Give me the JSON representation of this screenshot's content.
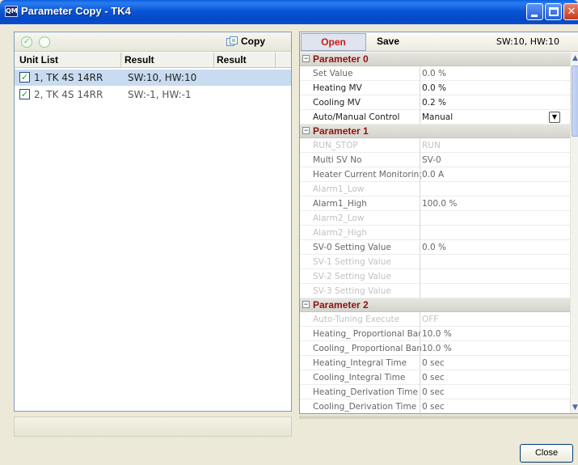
{
  "window": {
    "app_icon": "QM",
    "title": "Parameter Copy - TK4"
  },
  "left_panel": {
    "copy_label": "Copy",
    "headers": [
      "Unit List",
      "Result",
      "Result"
    ],
    "units": [
      {
        "label": "1, TK 4S 14RR",
        "result": "SW:10, HW:10",
        "checked": true,
        "selected": true
      },
      {
        "label": "2, TK 4S 14RR",
        "result": "SW:-1, HW:-1",
        "checked": true,
        "selected": false
      }
    ]
  },
  "right_panel": {
    "open_label": "Open",
    "save_label": "Save",
    "version": "SW:10, HW:10",
    "groups": [
      {
        "name": "Parameter 0",
        "rows": [
          {
            "name": "Set Value",
            "value": "0.0 %",
            "state": "gray"
          },
          {
            "name": "Heating MV",
            "value": "0.0 %",
            "state": "normal"
          },
          {
            "name": "Cooling MV",
            "value": "0.2 %",
            "state": "normal"
          },
          {
            "name": "Auto/Manual Control",
            "value": "Manual",
            "state": "normal",
            "dropdown": true
          }
        ]
      },
      {
        "name": "Parameter 1",
        "rows": [
          {
            "name": "RUN_STOP",
            "value": "RUN",
            "state": "disabled"
          },
          {
            "name": "Multi SV No",
            "value": "SV-0",
            "state": "gray"
          },
          {
            "name": "Heater Current Monitoring",
            "value": "0.0 A",
            "state": "gray"
          },
          {
            "name": "Alarm1_Low",
            "value": "",
            "state": "disabled"
          },
          {
            "name": "Alarm1_High",
            "value": "100.0 %",
            "state": "gray"
          },
          {
            "name": "Alarm2_Low",
            "value": "",
            "state": "disabled"
          },
          {
            "name": "Alarm2_High",
            "value": "",
            "state": "disabled"
          },
          {
            "name": "SV-0 Setting Value",
            "value": "0.0 %",
            "state": "gray"
          },
          {
            "name": "SV-1 Setting Value",
            "value": "",
            "state": "disabled"
          },
          {
            "name": "SV-2 Setting Value",
            "value": "",
            "state": "disabled"
          },
          {
            "name": "SV-3 Setting Value",
            "value": "",
            "state": "disabled"
          }
        ]
      },
      {
        "name": "Parameter 2",
        "rows": [
          {
            "name": "Auto-Tuning Execute",
            "value": "OFF",
            "state": "disabled"
          },
          {
            "name": "Heating_ Proportional Band",
            "value": "10.0 %",
            "state": "gray"
          },
          {
            "name": "Cooling_ Proportional Band",
            "value": "10.0 %",
            "state": "gray"
          },
          {
            "name": "Heating_Integral Time",
            "value": "0 sec",
            "state": "gray"
          },
          {
            "name": "Cooling_Integral Time",
            "value": "0 sec",
            "state": "gray"
          },
          {
            "name": "Heating_Derivation Time",
            "value": "0 sec",
            "state": "gray"
          },
          {
            "name": "Cooling_Derivation Time",
            "value": "0 sec",
            "state": "gray"
          }
        ]
      }
    ]
  },
  "footer": {
    "close_label": "Close"
  }
}
